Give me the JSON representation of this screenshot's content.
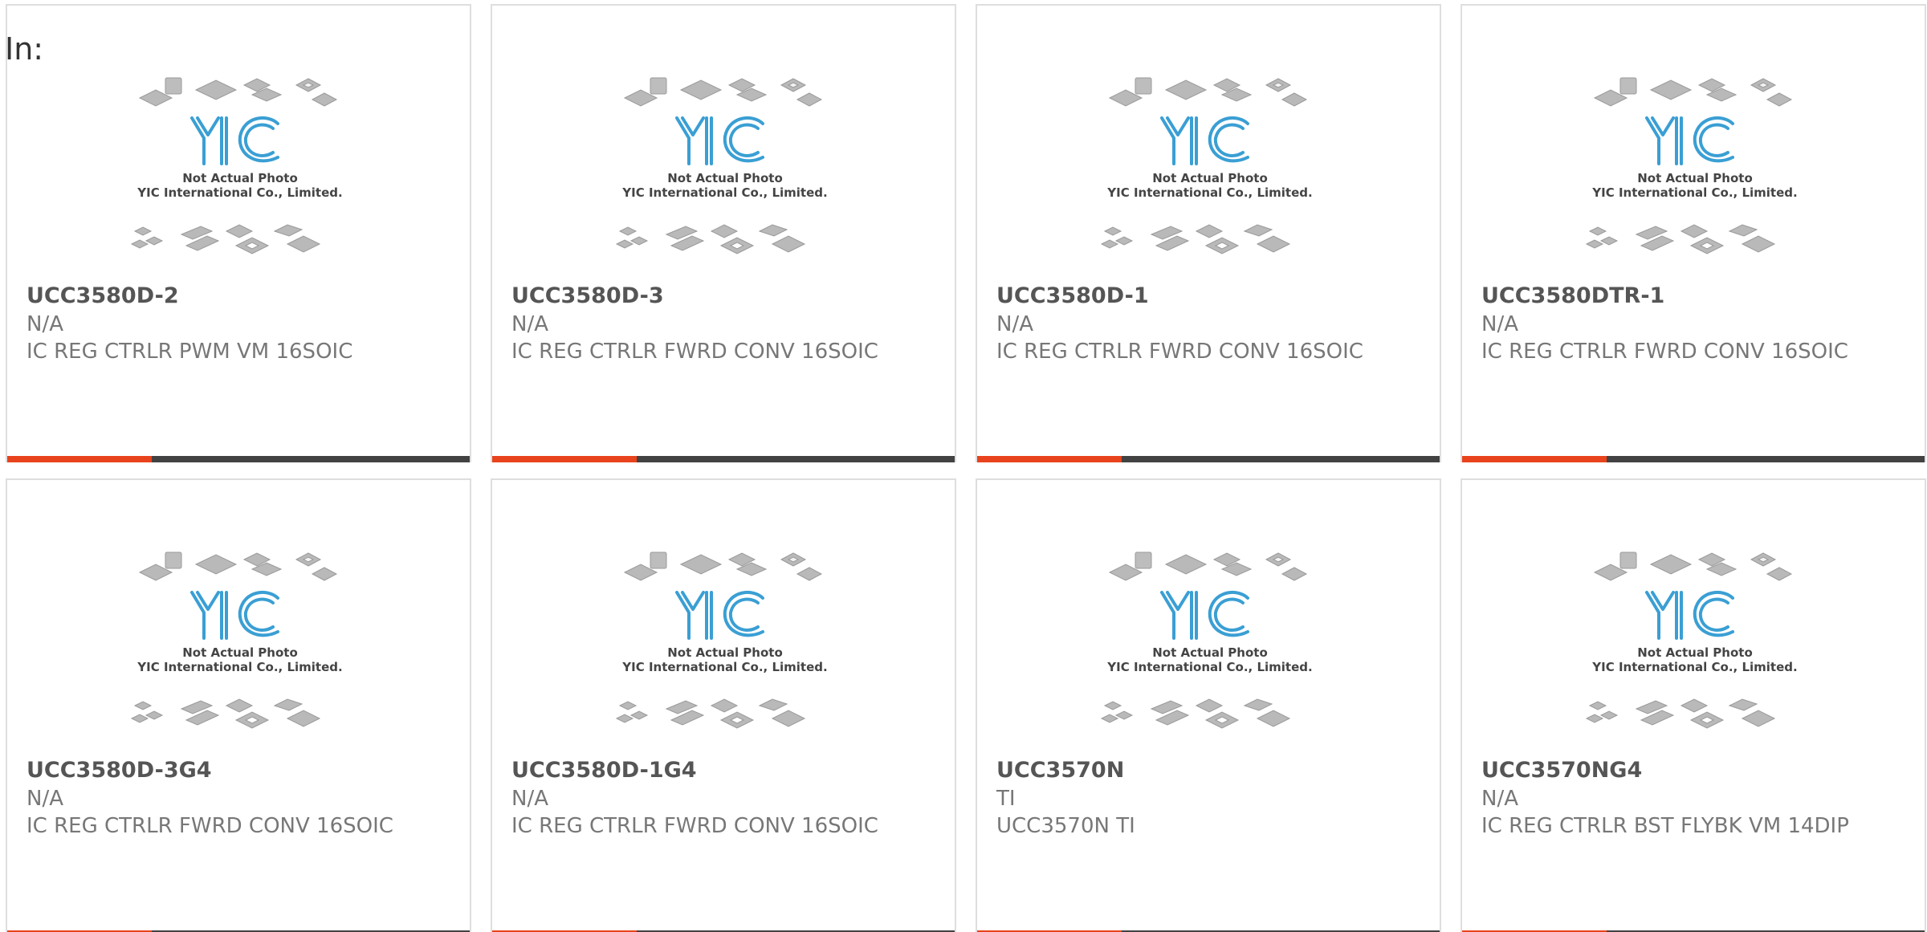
{
  "search": {
    "prefix_label": "In:"
  },
  "colors": {
    "accent": "#e8431c",
    "bar_track": "#424242",
    "logo_blue": "#3a9fd4"
  },
  "placeholder_image": {
    "icon": "chip-package-placeholder-image",
    "line1": "Not Actual Photo",
    "line2": "YIC International Co., Limited."
  },
  "products": [
    {
      "part_number": "UCC3580D-2",
      "manufacturer": "N/A",
      "description": "IC REG CTRLR PWM VM 16SOIC",
      "progress": 0.31
    },
    {
      "part_number": "UCC3580D-3",
      "manufacturer": "N/A",
      "description": "IC REG CTRLR FWRD CONV 16SOIC",
      "progress": 0.31
    },
    {
      "part_number": "UCC3580D-1",
      "manufacturer": "N/A",
      "description": "IC REG CTRLR FWRD CONV 16SOIC",
      "progress": 0.31
    },
    {
      "part_number": "UCC3580DTR-1",
      "manufacturer": "N/A",
      "description": "IC REG CTRLR FWRD CONV 16SOIC",
      "progress": 0.31
    },
    {
      "part_number": "UCC3580D-3G4",
      "manufacturer": "N/A",
      "description": "IC REG CTRLR FWRD CONV 16SOIC",
      "progress": 0.31
    },
    {
      "part_number": "UCC3580D-1G4",
      "manufacturer": "N/A",
      "description": "IC REG CTRLR FWRD CONV 16SOIC",
      "progress": 0.31
    },
    {
      "part_number": "UCC3570N",
      "manufacturer": "TI",
      "description": "UCC3570N TI",
      "progress": 0.31
    },
    {
      "part_number": "UCC3570NG4",
      "manufacturer": "N/A",
      "description": "IC REG CTRLR BST FLYBK VM 14DIP",
      "progress": 0.31
    }
  ]
}
